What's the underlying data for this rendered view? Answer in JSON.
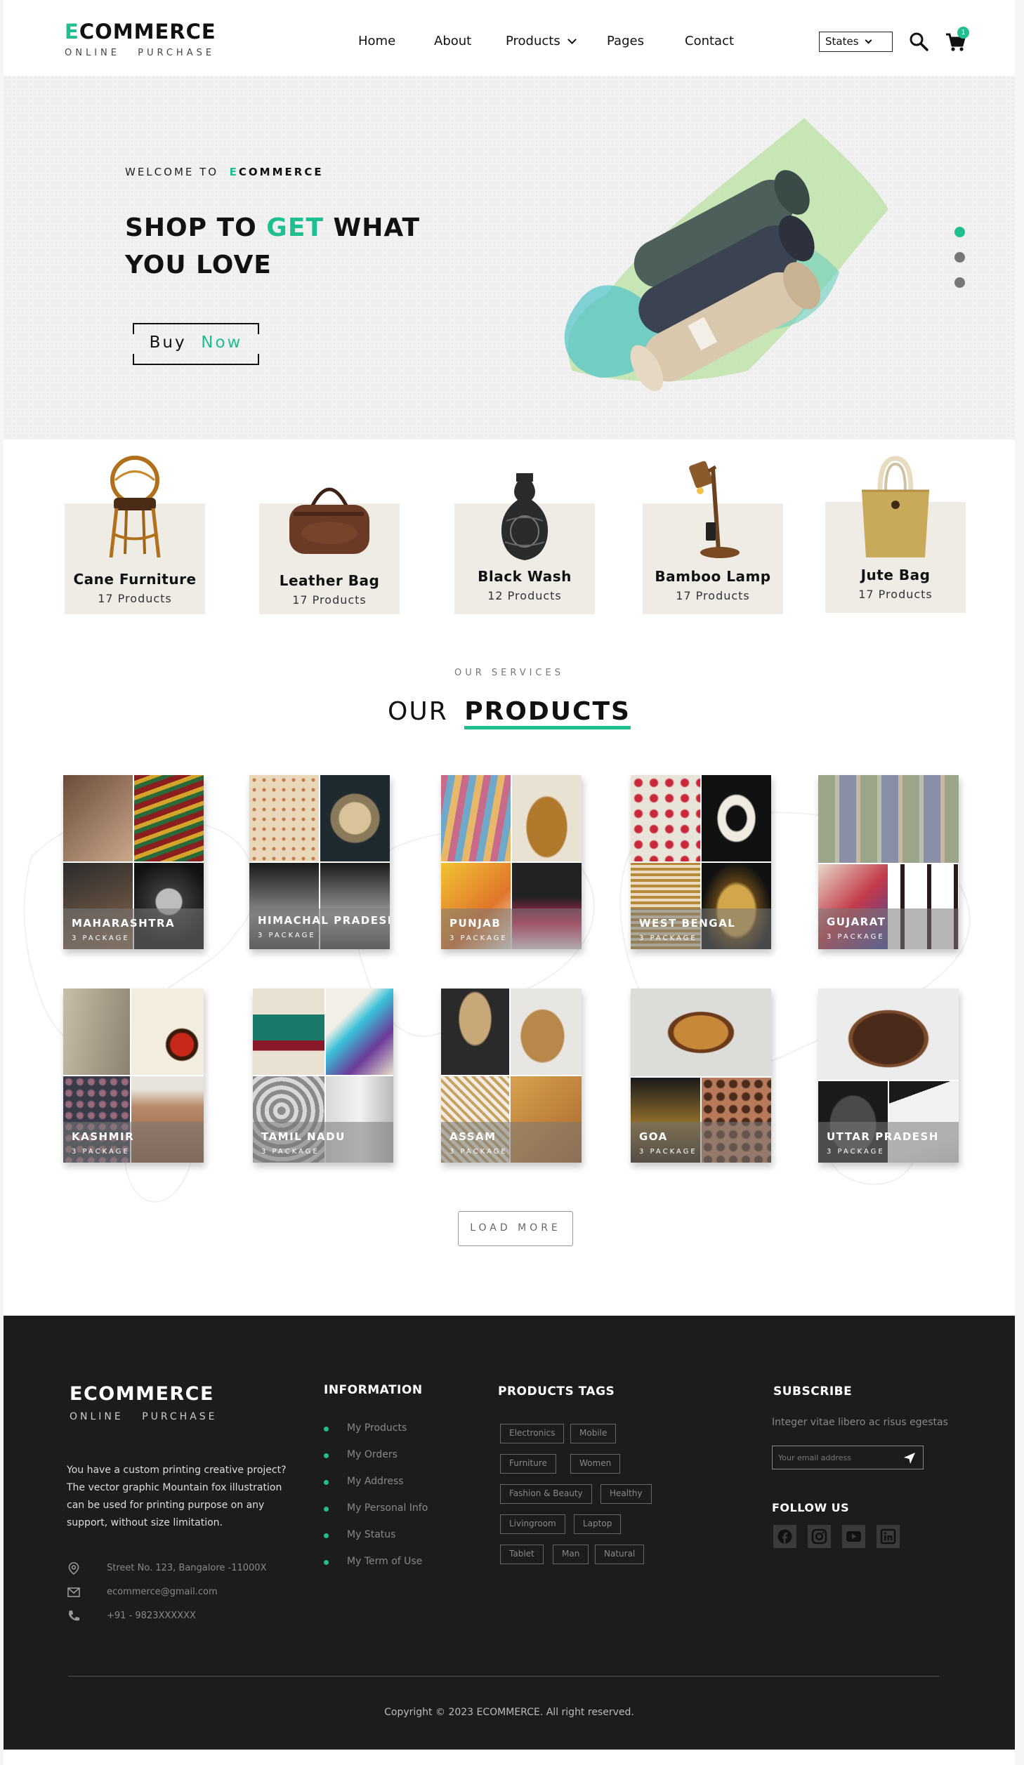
{
  "header": {
    "logo_title_first": "E",
    "logo_title_rest": "COMMERCE",
    "logo_sub": "ONLINE PURCHASE",
    "nav": [
      "Home",
      "About",
      "Products",
      "Pages",
      "Contact"
    ],
    "states_select": "States",
    "cart_count": "1"
  },
  "hero": {
    "welcome": "WELCOME TO",
    "welcome_brand_first": "E",
    "welcome_brand_rest": "COMMERCE",
    "title_part1": "SHOP TO",
    "title_accent": "GET",
    "title_part2": "WHAT YOU LOVE",
    "buy_label": "Buy",
    "buy_accent": "Now"
  },
  "categories": [
    {
      "name": "Cane Furniture",
      "count": "17 Products"
    },
    {
      "name": "Leather Bag",
      "count": "17 Products"
    },
    {
      "name": "Black Wash",
      "count": "12 Products"
    },
    {
      "name": "Bamboo Lamp",
      "count": "17 Products"
    },
    {
      "name": "Jute Bag",
      "count": "17 Products"
    }
  ],
  "products_section": {
    "label": "OUR SERVICES",
    "title_light": "OUR",
    "title_bold": "PRODUCTS",
    "load_more": "LOAD MORE",
    "items": [
      {
        "name": "MAHARASHTRA",
        "pkg": "3 PACKAGE"
      },
      {
        "name": "HIMACHAL PRADESH",
        "pkg": "3 PACKAGE"
      },
      {
        "name": "PUNJAB",
        "pkg": "3 PACKAGE"
      },
      {
        "name": "WEST BENGAL",
        "pkg": "3 PACKAGE"
      },
      {
        "name": "GUJARAT",
        "pkg": "3 PACKAGE"
      },
      {
        "name": "KASHMIR",
        "pkg": "3 PACKAGE"
      },
      {
        "name": "TAMIL NADU",
        "pkg": "3 PACKAGE"
      },
      {
        "name": "ASSAM",
        "pkg": "3 PACKAGE"
      },
      {
        "name": "GOA",
        "pkg": "3 PACKAGE"
      },
      {
        "name": "UTTAR PRADESH",
        "pkg": "3 PACKAGE"
      }
    ]
  },
  "footer": {
    "logo": "ECOMMERCE",
    "logo_sub": "ONLINE PURCHASE",
    "description": "You have a custom printing creative project? The vector graphic Mountain fox illustration can be used for printing purpose on any support, without size limitation.",
    "address": "Street No. 123, Bangalore -11000X",
    "email": "ecommerce@gmail.com",
    "phone": "+91 - 9823XXXXXX",
    "info_heading": "INFORMATION",
    "info_links": [
      "My Products",
      "My Orders",
      "My Address",
      "My Personal Info",
      "My Status",
      "My Term of Use"
    ],
    "tags_heading": "PRODUCTS TAGS",
    "tags": [
      "Electronics",
      "Mobile",
      "Furniture",
      "Women",
      "Fashion & Beauty",
      "Healthy",
      "Livingroom",
      "Laptop",
      "Tablet",
      "Man",
      "Natural"
    ],
    "subscribe_heading": "SUBSCRIBE",
    "subscribe_text": "Integer vitae libero ac risus egestas",
    "email_placeholder": "Your email address",
    "follow_heading": "FOLLOW US",
    "copyright": "Copyright © 2023 ECOMMERCE. All right reserved."
  },
  "colors": {
    "accent": "#1fbf8f",
    "footer_bg": "#1c1c1c"
  }
}
